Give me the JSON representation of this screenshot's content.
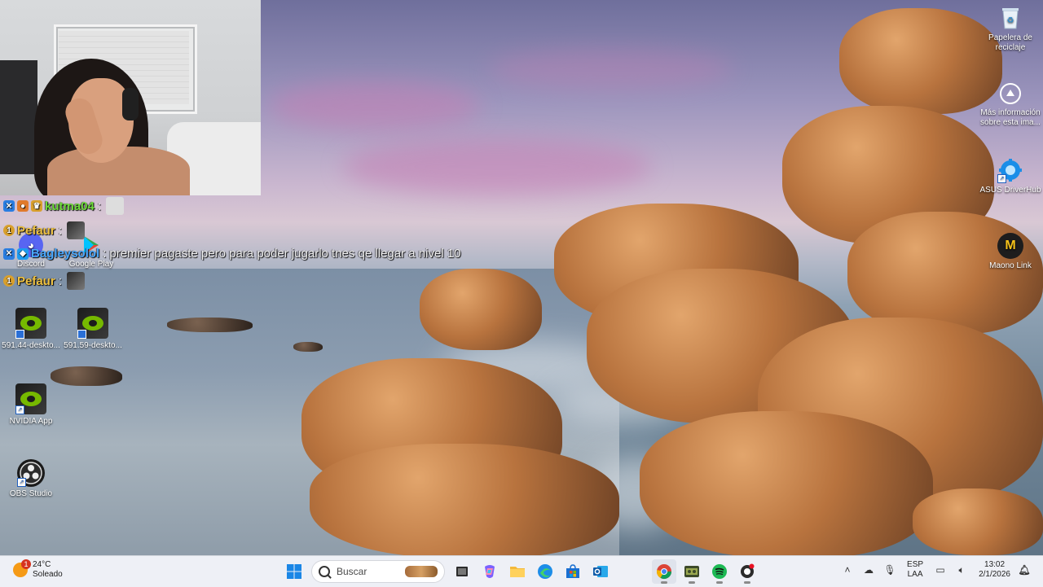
{
  "chat": {
    "line1": {
      "user": "kutma04",
      "sep": ":"
    },
    "line2": {
      "user": "Pefaur",
      "sep": ":"
    },
    "line3": {
      "user": "Bagleysolol",
      "sep": ":",
      "message": "premier pagaste pero para poder jugarlo tnes qe llegar a nivel 10"
    },
    "line4": {
      "user": "Pefaur",
      "sep": ":"
    },
    "colors": {
      "kutma04": "#6fdc3c",
      "Pefaur": "#f0c342",
      "Bagleysolol": "#4aa8ff"
    }
  },
  "desktop_icons": {
    "discord": "Discord",
    "google_play": "Google Play",
    "nvidia_driver_1": "591.44-deskto...",
    "nvidia_driver_2": "591.59-deskto...",
    "nvidia_app": "NVIDIA App",
    "obs": "OBS Studio",
    "recycle_bin": "Papelera de reciclaje",
    "more_info": "Más información sobre esta ima...",
    "asus_driverhub": "ASUS DriverHub",
    "maono_link": "Maono Link"
  },
  "taskbar": {
    "weather": {
      "temp": "24°C",
      "condition": "Soleado",
      "alert_count": "1"
    },
    "search_placeholder": "Buscar",
    "language": {
      "lang": "ESP",
      "layout": "LAA"
    },
    "clock": {
      "time": "13:02",
      "date": "2/1/2026"
    },
    "icons": [
      "windows-start",
      "search",
      "task-view",
      "copilot",
      "file-explorer",
      "edge",
      "store",
      "outlook",
      "chrome",
      "app-generic",
      "spotify",
      "game-app"
    ]
  }
}
